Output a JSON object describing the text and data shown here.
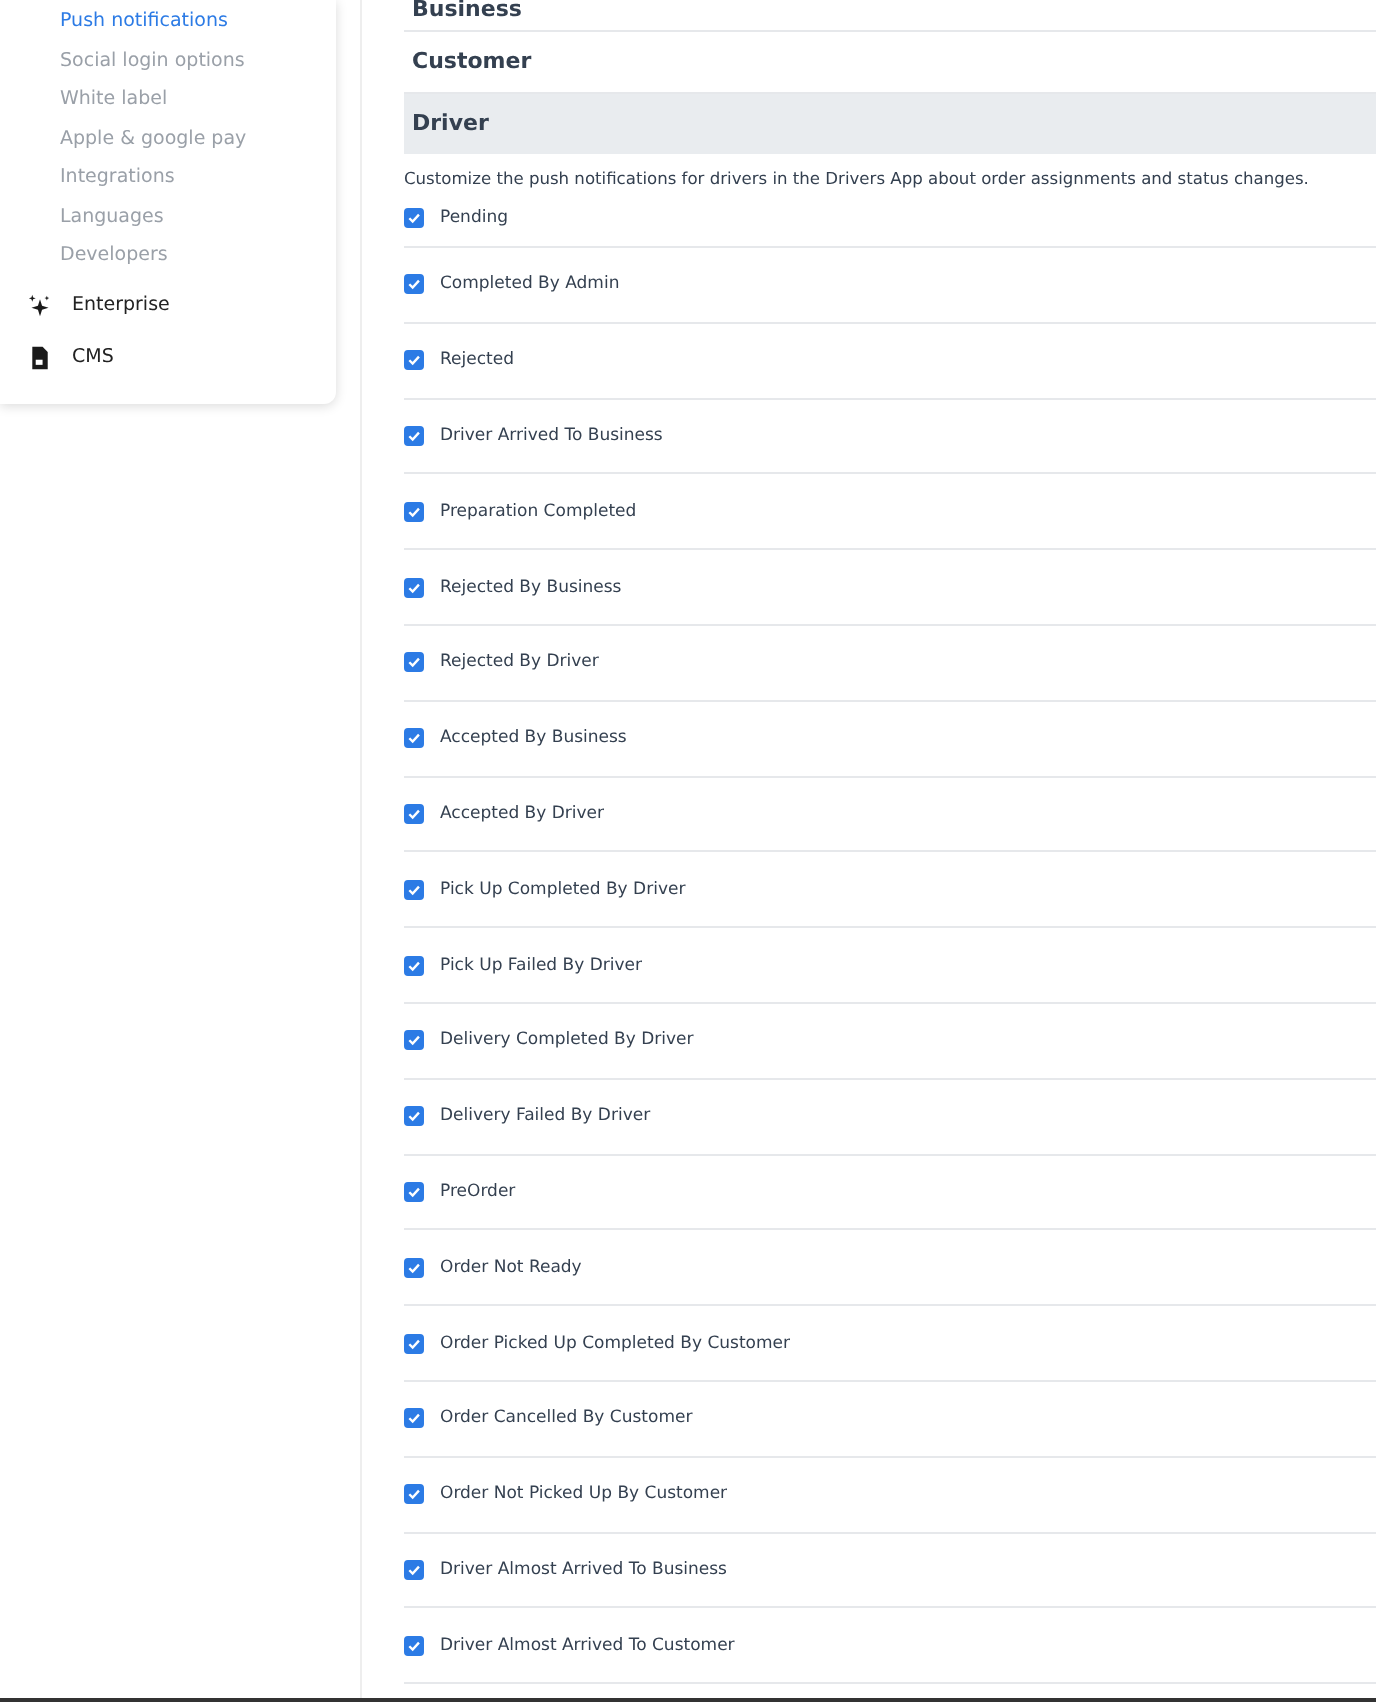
{
  "sidebar": {
    "sub_items": [
      {
        "label": "Push notifications",
        "selected": true
      },
      {
        "label": "Social login options",
        "selected": false
      },
      {
        "label": "White label",
        "selected": false
      },
      {
        "label": "Apple & google pay",
        "selected": false
      },
      {
        "label": "Integrations",
        "selected": false
      },
      {
        "label": "Languages",
        "selected": false
      },
      {
        "label": "Developers",
        "selected": false
      }
    ],
    "items": [
      {
        "label": "Enterprise",
        "kind": "sparkle"
      },
      {
        "label": "CMS",
        "kind": "document"
      }
    ]
  },
  "sections": [
    {
      "title": "Business",
      "selected": false
    },
    {
      "title": "Customer",
      "selected": false
    },
    {
      "title": "Driver",
      "selected": true
    }
  ],
  "description": "Customize the push notifications for drivers in the Drivers App about order assignments and status changes.",
  "notifications": [
    {
      "label": "Pending",
      "checked": true
    },
    {
      "label": "Completed By Admin",
      "checked": true
    },
    {
      "label": "Rejected",
      "checked": true
    },
    {
      "label": "Driver Arrived To Business",
      "checked": true
    },
    {
      "label": "Preparation Completed",
      "checked": true
    },
    {
      "label": "Rejected By Business",
      "checked": true
    },
    {
      "label": "Rejected By Driver",
      "checked": true
    },
    {
      "label": "Accepted By Business",
      "checked": true
    },
    {
      "label": "Accepted By Driver",
      "checked": true
    },
    {
      "label": "Pick Up Completed By Driver",
      "checked": true
    },
    {
      "label": "Pick Up Failed By Driver",
      "checked": true
    },
    {
      "label": "Delivery Completed By Driver",
      "checked": true
    },
    {
      "label": "Delivery Failed By Driver",
      "checked": true
    },
    {
      "label": "PreOrder",
      "checked": true
    },
    {
      "label": "Order Not Ready",
      "checked": true
    },
    {
      "label": "Order Picked Up Completed By Customer",
      "checked": true
    },
    {
      "label": "Order Cancelled By Customer",
      "checked": true
    },
    {
      "label": "Order Not Picked Up By Customer",
      "checked": true
    },
    {
      "label": "Driver Almost Arrived To Business",
      "checked": true
    },
    {
      "label": "Driver Almost Arrived To Customer",
      "checked": true
    }
  ]
}
